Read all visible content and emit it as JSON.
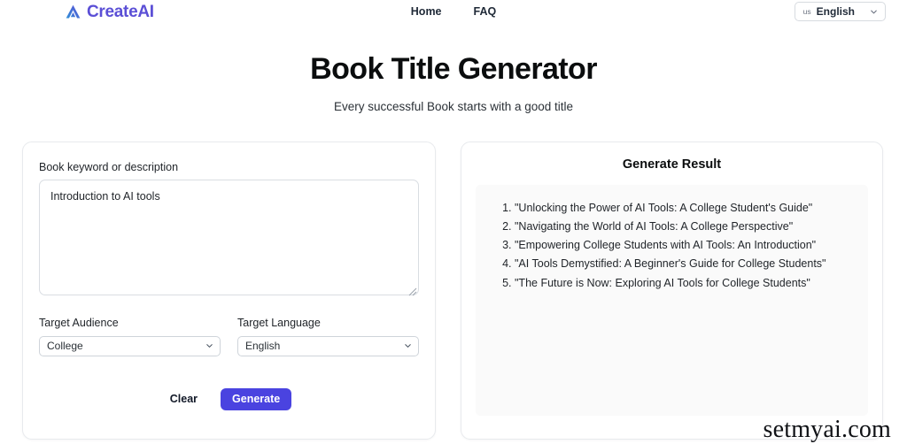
{
  "header": {
    "brand": {
      "icon": "delta-logo-icon",
      "name": "CreateAI"
    },
    "nav": [
      {
        "label": "Home",
        "name": "nav-link-home"
      },
      {
        "label": "FAQ",
        "name": "nav-link-faq"
      }
    ],
    "language_selector": {
      "flag_label": "us",
      "value": "English",
      "caret_icon": "chevron-down-icon"
    }
  },
  "hero": {
    "title": "Book Title Generator",
    "subtitle": "Every successful Book starts with a good title"
  },
  "form": {
    "keyword_label": "Book keyword or description",
    "keyword_value": "Introduction to AI tools",
    "keyword_placeholder": "Book keyword or description",
    "audience_label": "Target Audience",
    "audience_value": "College",
    "audience_options": [
      "College"
    ],
    "language_label": "Target Language",
    "language_value": "English",
    "language_options": [
      "English"
    ],
    "clear_label": "Clear",
    "generate_label": "Generate"
  },
  "result": {
    "title": "Generate Result",
    "items": [
      "\"Unlocking the Power of AI Tools: A College Student's Guide\"",
      "\"Navigating the World of AI Tools: A College Perspective\"",
      "\"Empowering College Students with AI Tools: An Introduction\"",
      "\"AI Tools Demystified: A Beginner's Guide for College Students\"",
      "\"The Future is Now: Exploring AI Tools for College Students\""
    ]
  },
  "watermark": "setmyai.com",
  "colors": {
    "brand": "#5b4fd6",
    "accent": "#4a43e0",
    "card_border": "#e8eaed",
    "result_panel_bg": "#fafafa"
  }
}
